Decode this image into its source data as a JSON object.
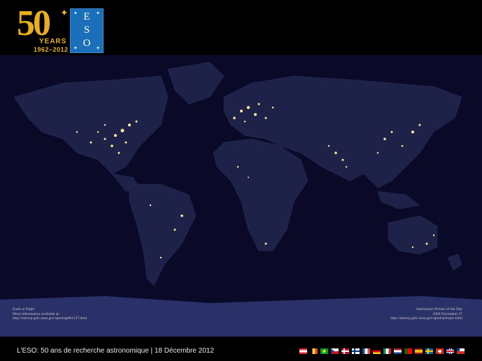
{
  "logo": {
    "anniversary_number": "50",
    "years_label": "YEARS",
    "range_label": "1962–2012",
    "eso_letters": [
      "E",
      "S",
      "O"
    ]
  },
  "map": {
    "caption_left": [
      "Earth at Night",
      "More information available at:",
      "http://antwrp.gsfc.nasa.gov/apod/ap001127.html"
    ],
    "caption_right": [
      "Astronomy Picture of the Day",
      "2000 November 27",
      "http://antwrp.gsfc.nasa.gov/apod/astropix.html"
    ]
  },
  "footer": {
    "text": "L'ESO: 50 ans de recherche  astronomique | 18 Décembre 2012"
  },
  "flags": [
    "austria-flag",
    "belgium-flag",
    "brazil-flag",
    "czech-flag",
    "denmark-flag",
    "finland-flag",
    "france-flag",
    "germany-flag",
    "italy-flag",
    "netherlands-flag",
    "portugal-flag",
    "spain-flag",
    "sweden-flag",
    "switzerland-flag",
    "uk-flag",
    "chile-flag"
  ]
}
